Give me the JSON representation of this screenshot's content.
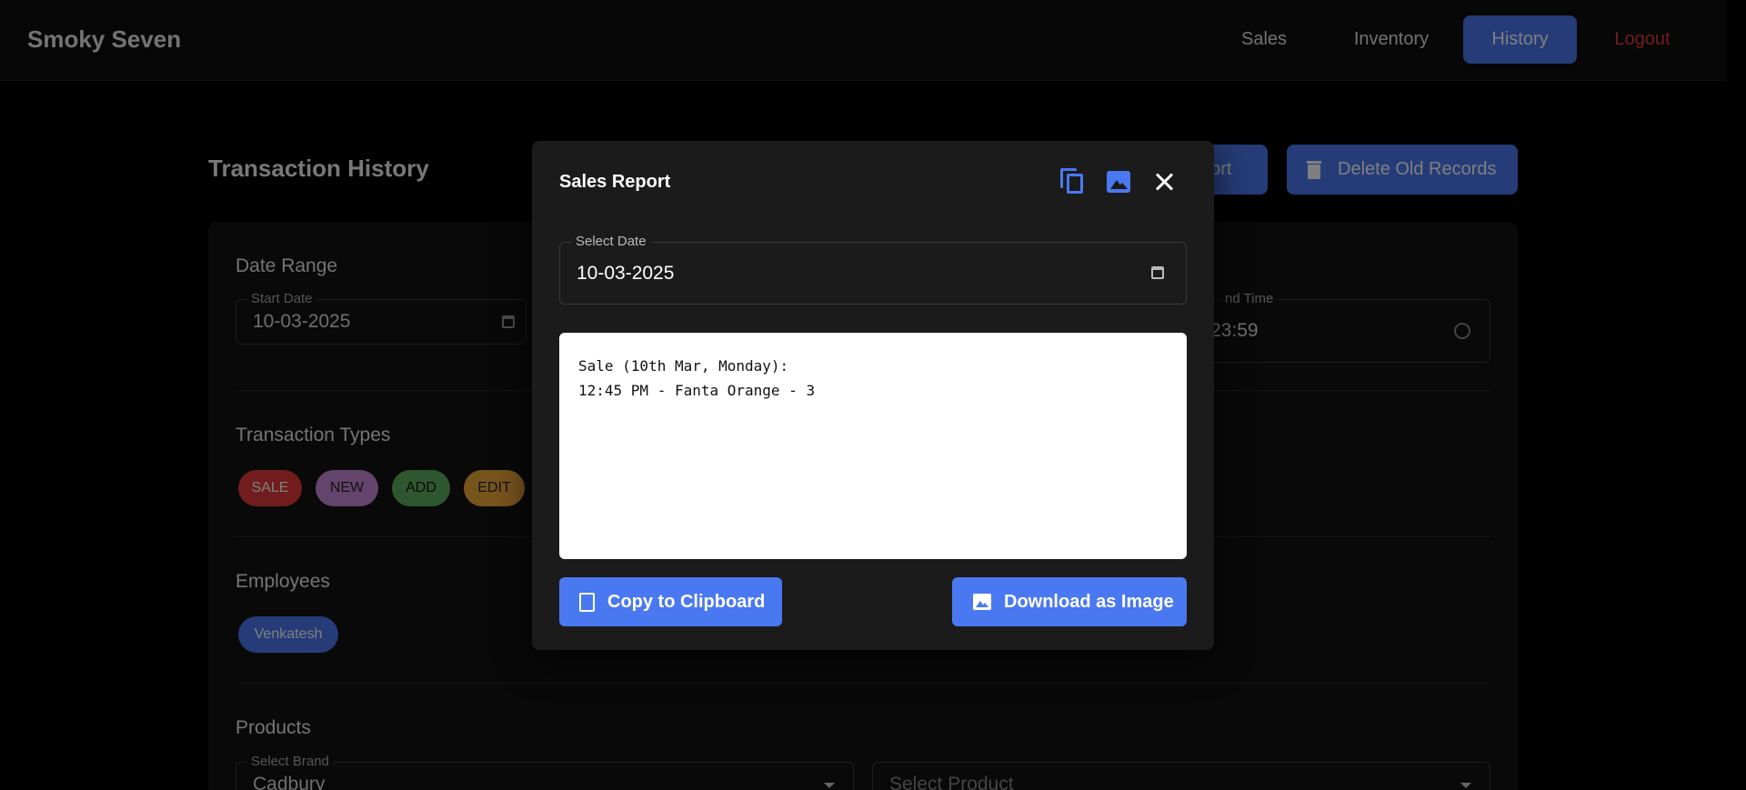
{
  "app": {
    "brand": "Smoky Seven",
    "nav": {
      "sales": "Sales",
      "inventory": "Inventory",
      "history": "History",
      "logout": "Logout"
    }
  },
  "page": {
    "title": "Transaction History",
    "export_label": "port",
    "delete_label": "Delete Old Records",
    "date_range": {
      "title": "Date Range",
      "start_date_label": "Start Date",
      "start_date_value": "10-03-2025",
      "end_time_label": "nd Time",
      "end_time_value": "23:59"
    },
    "transaction_types": {
      "title": "Transaction Types",
      "chips": [
        "SALE",
        "NEW",
        "ADD",
        "EDIT"
      ]
    },
    "employees": {
      "title": "Employees",
      "chips": [
        "Venkatesh"
      ]
    },
    "products": {
      "title": "Products",
      "brand_label": "Select Brand",
      "brand_value": "Cadbury",
      "product_placeholder": "Select Product"
    }
  },
  "modal": {
    "title": "Sales Report",
    "date_label": "Select Date",
    "date_value": "10-03-2025",
    "report_line1": "Sale (10th Mar, Monday):",
    "report_line2": "12:45 PM - Fanta Orange - 3",
    "copy_button": "Copy to Clipboard",
    "download_button": "Download as Image",
    "icons": [
      "copy-icon",
      "image-icon",
      "close-icon"
    ]
  },
  "colors": {
    "accent": "#4a78f0",
    "logout": "#e23b3b",
    "sale": "#e23b3b",
    "new": "#c888d8",
    "add": "#5fae5f",
    "edit": "#f1a93a"
  }
}
